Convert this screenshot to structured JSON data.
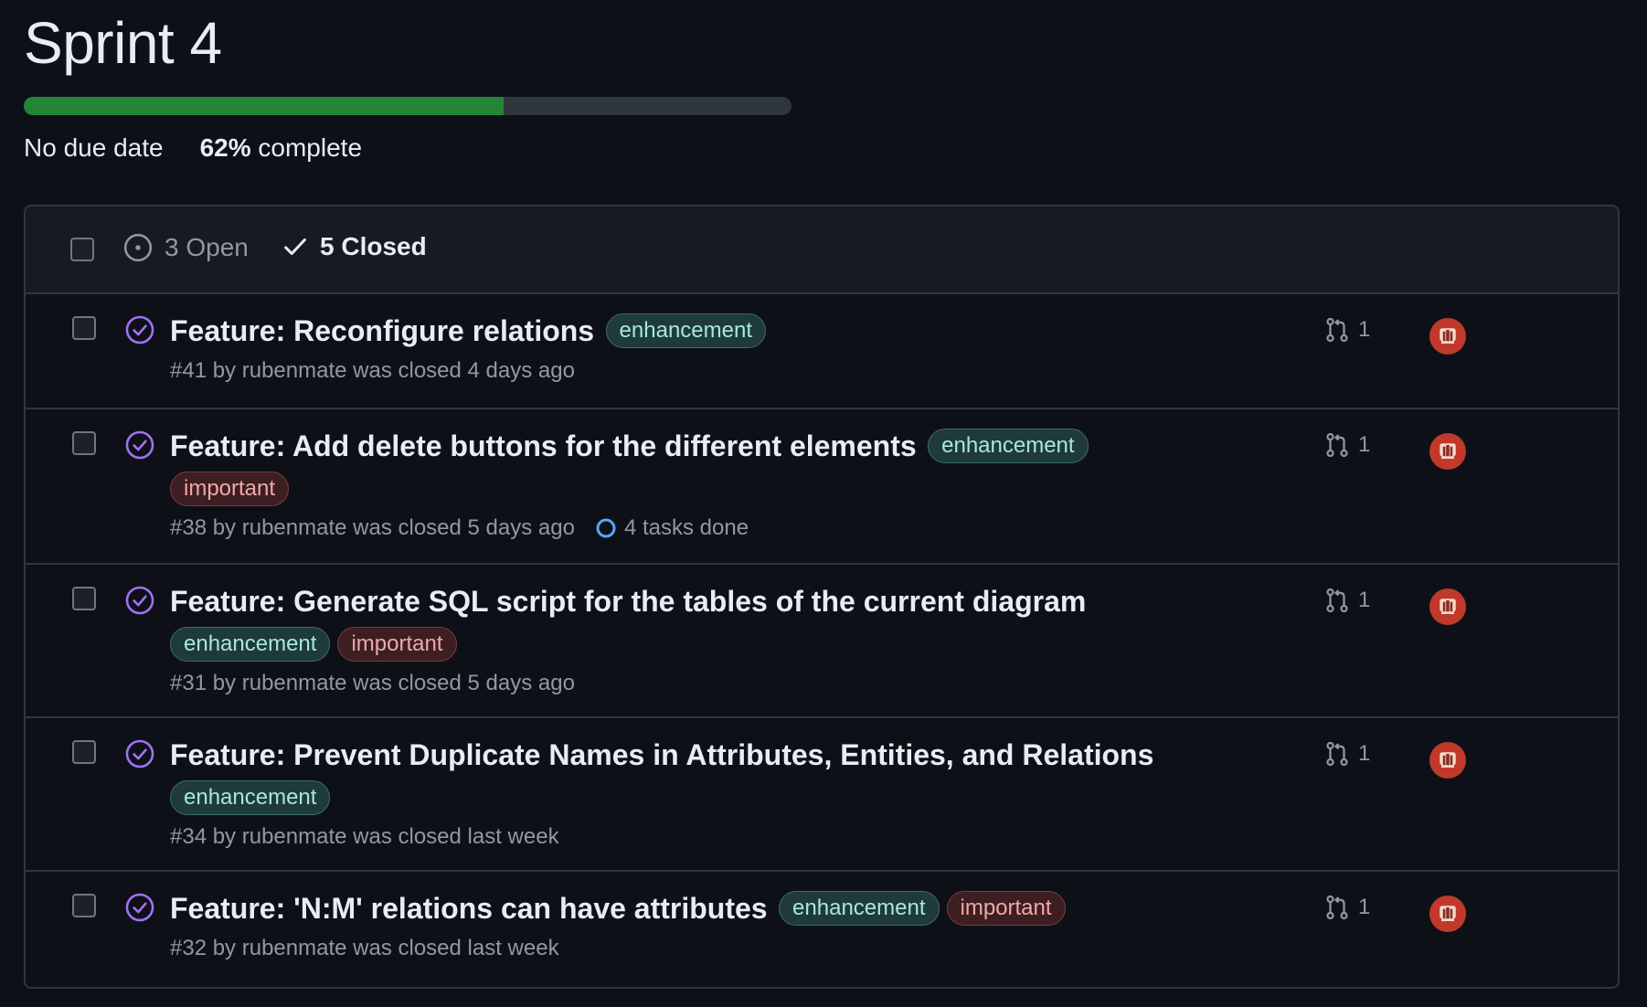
{
  "milestone": {
    "title": "Sprint 4",
    "due": "No due date",
    "percent": "62%",
    "percent_suffix": " complete",
    "progress": 0.625
  },
  "filters": {
    "open_label": "3 Open",
    "closed_label": "5 Closed"
  },
  "issues": [
    {
      "title": "Feature: Reconfigure relations",
      "labels": [
        "enhancement"
      ],
      "meta": "#41 by rubenmate was closed 4 days ago",
      "tasks": "",
      "pr_count": "1"
    },
    {
      "title": "Feature: Add delete buttons for the different elements",
      "labels": [
        "enhancement",
        "important"
      ],
      "meta": "#38 by rubenmate was closed 5 days ago",
      "tasks": "4 tasks done",
      "pr_count": "1"
    },
    {
      "title": "Feature: Generate SQL script for the tables of the current diagram",
      "labels": [
        "enhancement",
        "important"
      ],
      "meta": "#31 by rubenmate was closed 5 days ago",
      "tasks": "",
      "pr_count": "1"
    },
    {
      "title": "Feature: Prevent Duplicate Names in Attributes, Entities, and Relations",
      "labels": [
        "enhancement"
      ],
      "meta": "#34 by rubenmate was closed last week",
      "tasks": "",
      "pr_count": "1"
    },
    {
      "title": "Feature: 'N:M' relations can have attributes",
      "labels": [
        "enhancement",
        "important"
      ],
      "meta": "#32 by rubenmate was closed last week",
      "tasks": "",
      "pr_count": "1"
    }
  ],
  "colors": {
    "background": "#0d1117",
    "progress_fill": "#238636",
    "closed_icon": "#a371f7",
    "task_ring": "#58a6ff"
  }
}
